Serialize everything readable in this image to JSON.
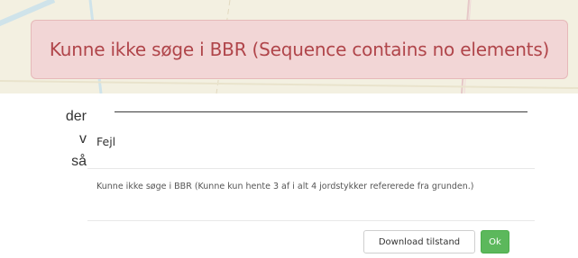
{
  "colors": {
    "map_background": "#f3f0e1",
    "alert_background": "#f2d6d6",
    "alert_text": "#b0454a",
    "ok_button": "#5cb85c"
  },
  "alert": {
    "message": "Kunne ikke søge i BBR (Sequence contains no elements)"
  },
  "background_text": {
    "lines": [
      "der",
      "v",
      "så"
    ]
  },
  "modal": {
    "title": "Fejl",
    "body": "Kunne ikke søge i BBR (Kunne kun hente 3 af i alt 4 jordstykker refererede fra grunden.)",
    "buttons": {
      "download_label": "Download tilstand",
      "ok_label": "Ok"
    }
  }
}
